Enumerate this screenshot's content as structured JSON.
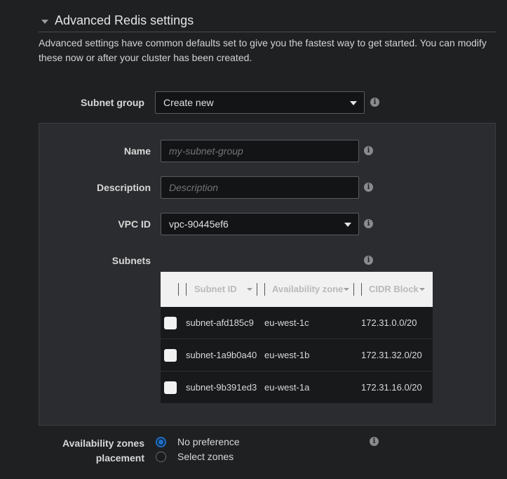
{
  "section": {
    "title": "Advanced Redis settings",
    "intro": "Advanced settings have common defaults set to give you the fastest way to get started. You can modify these now or after your cluster has been created."
  },
  "subnet_group": {
    "label": "Subnet group",
    "value": "Create new"
  },
  "form": {
    "name_label": "Name",
    "name_placeholder": "my-subnet-group",
    "description_label": "Description",
    "description_placeholder": "Description",
    "vpc_label": "VPC ID",
    "vpc_value": "vpc-90445ef6",
    "subnets_label": "Subnets"
  },
  "subnets_table": {
    "columns": [
      "Subnet ID",
      "Availability zone",
      "CIDR Block"
    ],
    "rows": [
      {
        "subnet_id": "subnet-afd185c9",
        "zone": "eu-west-1c",
        "cidr": "172.31.0.0/20",
        "checked": false
      },
      {
        "subnet_id": "subnet-1a9b0a40",
        "zone": "eu-west-1b",
        "cidr": "172.31.32.0/20",
        "checked": false
      },
      {
        "subnet_id": "subnet-9b391ed3",
        "zone": "eu-west-1a",
        "cidr": "172.31.16.0/20",
        "checked": false
      }
    ]
  },
  "placement": {
    "label_line1": "Availability zones",
    "label_line2": "placement",
    "options": [
      {
        "label": "No preference",
        "selected": true
      },
      {
        "label": "Select zones",
        "selected": false
      }
    ]
  },
  "icons": {
    "info": "info-icon",
    "info_glyph": "i",
    "caret": "caret-down-icon"
  },
  "colors": {
    "background": "#1f2022",
    "panel": "#2b2c2f",
    "accent": "#1f6fc5"
  }
}
